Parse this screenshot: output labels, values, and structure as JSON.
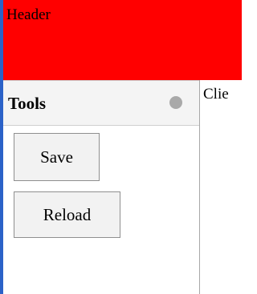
{
  "header": {
    "title": "Header",
    "background_color": "#ff0000"
  },
  "tools": {
    "title": "Tools",
    "status_icon": "status-dot-icon",
    "buttons": [
      {
        "label": "Save"
      },
      {
        "label": "Reload"
      }
    ]
  },
  "client": {
    "text": "Clie"
  },
  "colors": {
    "window_edge": "#2b62c8",
    "panel_header": "#f4f4f4",
    "status_dot": "#a9a9a9"
  }
}
